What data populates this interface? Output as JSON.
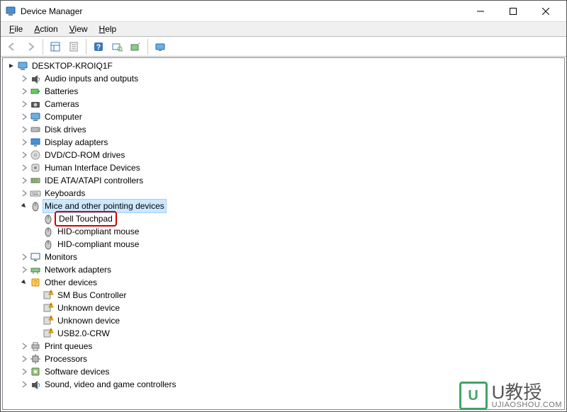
{
  "window": {
    "title": "Device Manager"
  },
  "menubar": {
    "items": [
      "File",
      "Action",
      "View",
      "Help"
    ]
  },
  "tree": {
    "root": "DESKTOP-KROIQ1F",
    "nodes": [
      {
        "label": "Audio inputs and outputs",
        "icon": "audio",
        "expandable": true,
        "expanded": false,
        "depth": 1
      },
      {
        "label": "Batteries",
        "icon": "battery",
        "expandable": true,
        "expanded": false,
        "depth": 1
      },
      {
        "label": "Cameras",
        "icon": "camera",
        "expandable": true,
        "expanded": false,
        "depth": 1
      },
      {
        "label": "Computer",
        "icon": "computer",
        "expandable": true,
        "expanded": false,
        "depth": 1
      },
      {
        "label": "Disk drives",
        "icon": "disk",
        "expandable": true,
        "expanded": false,
        "depth": 1
      },
      {
        "label": "Display adapters",
        "icon": "display",
        "expandable": true,
        "expanded": false,
        "depth": 1
      },
      {
        "label": "DVD/CD-ROM drives",
        "icon": "dvd",
        "expandable": true,
        "expanded": false,
        "depth": 1
      },
      {
        "label": "Human Interface Devices",
        "icon": "hid",
        "expandable": true,
        "expanded": false,
        "depth": 1
      },
      {
        "label": "IDE ATA/ATAPI controllers",
        "icon": "ide",
        "expandable": true,
        "expanded": false,
        "depth": 1
      },
      {
        "label": "Keyboards",
        "icon": "keyboard",
        "expandable": true,
        "expanded": false,
        "depth": 1
      },
      {
        "label": "Mice and other pointing devices",
        "icon": "mouse",
        "expandable": true,
        "expanded": true,
        "depth": 1,
        "selected": true
      },
      {
        "label": "Dell Touchpad",
        "icon": "mouse",
        "expandable": false,
        "depth": 2,
        "highlight": true
      },
      {
        "label": "HID-compliant mouse",
        "icon": "mouse",
        "expandable": false,
        "depth": 2
      },
      {
        "label": "HID-compliant mouse",
        "icon": "mouse",
        "expandable": false,
        "depth": 2
      },
      {
        "label": "Monitors",
        "icon": "monitor",
        "expandable": true,
        "expanded": false,
        "depth": 1
      },
      {
        "label": "Network adapters",
        "icon": "network",
        "expandable": true,
        "expanded": false,
        "depth": 1
      },
      {
        "label": "Other devices",
        "icon": "other",
        "expandable": true,
        "expanded": true,
        "depth": 1
      },
      {
        "label": "SM Bus Controller",
        "icon": "warn",
        "expandable": false,
        "depth": 2
      },
      {
        "label": "Unknown device",
        "icon": "warn",
        "expandable": false,
        "depth": 2
      },
      {
        "label": "Unknown device",
        "icon": "warn",
        "expandable": false,
        "depth": 2
      },
      {
        "label": "USB2.0-CRW",
        "icon": "warn",
        "expandable": false,
        "depth": 2
      },
      {
        "label": "Print queues",
        "icon": "printer",
        "expandable": true,
        "expanded": false,
        "depth": 1
      },
      {
        "label": "Processors",
        "icon": "cpu",
        "expandable": true,
        "expanded": false,
        "depth": 1
      },
      {
        "label": "Software devices",
        "icon": "software",
        "expandable": true,
        "expanded": false,
        "depth": 1
      },
      {
        "label": "Sound, video and game controllers",
        "icon": "audio",
        "expandable": true,
        "expanded": false,
        "depth": 1
      }
    ]
  },
  "watermark": {
    "brand": "U教授",
    "url": "UJIAOSHOU.COM"
  }
}
